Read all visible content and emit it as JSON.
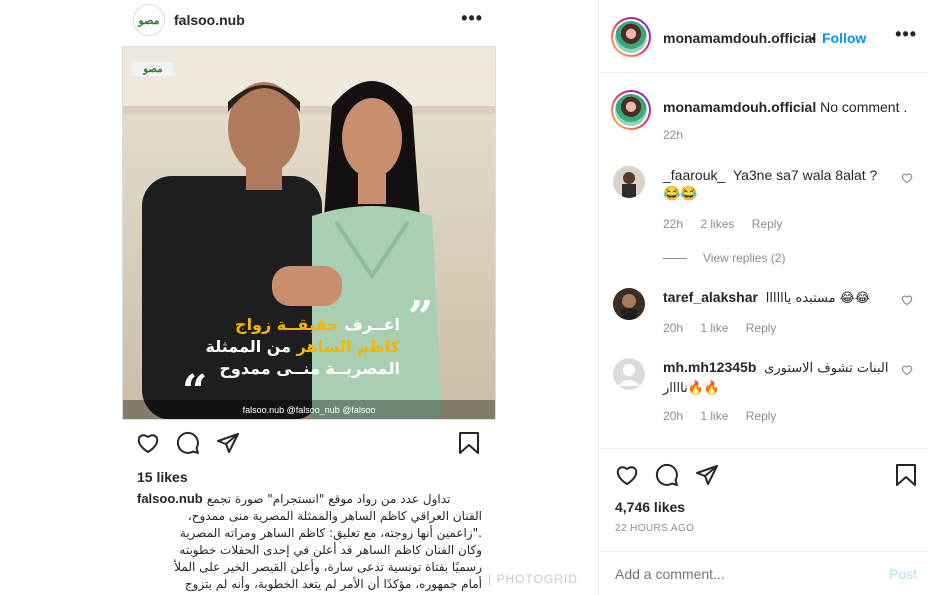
{
  "post": {
    "username": "falsoo.nub",
    "logo_text": "مصو",
    "more": "•••",
    "headline_line1_pre": "اعــرف ",
    "headline_line1_hl": "حقيقــة زواج",
    "headline_line2_hl": "كاظم الساهر",
    "headline_line2_post": " من الممثلة",
    "headline_line3": "المصريــة منــى ممدوح",
    "footer_social": "falsoo.nub  @falsoo_nub  @falsoo",
    "likes": "15 likes",
    "caption_user": "falsoo.nub",
    "caption_lines": [
      "تداول عدد من رواد موقع \"انستجرام\" صورة تجمع",
      "الفنان العراقي كاظم الساهر والممثلة المصرية منى ممدوح،",
      ".\"زاعمين أنها زوجته، مع تعليق: كاظم الساهر ومراته المصرية",
      "وكان الفنان كاظم الساهر قد أعلن في إحدى الحفلات خطوبته",
      "رسميًا بفتاة تونسية تدعى سارة، وأعلن القيصر الخير على الملأ",
      "أمام جمهوره، مؤكدًا أن الأمر لم يتعد الخطوبة، وأنه لم يتزوج"
    ],
    "watermark": "| PHOTOGRID"
  },
  "panel": {
    "username": "monamamdouh.official",
    "dot": "•",
    "follow": "Follow",
    "more": "•••"
  },
  "comments": [
    {
      "user": "monamamdouh.official",
      "text": "No comment .",
      "time": "22h"
    },
    {
      "user": "_faarouk_",
      "text": "Ya3ne sa7 wala 8alat ? 😂😂",
      "time": "22h",
      "likes": "2 likes",
      "reply": "Reply"
    },
    {
      "user": "taref_alakshar",
      "text": "مستبده ياااااا 😂😂",
      "time": "20h",
      "likes": "1 like",
      "reply": "Reply"
    },
    {
      "user": "mh.mh12345b",
      "text": "البنات تشوف الاستورى ناااار🔥🔥",
      "time": "20h",
      "likes": "1 like",
      "reply": "Reply"
    }
  ],
  "view_replies": "View replies (2)",
  "actions": {
    "likes": "4,746 likes",
    "time": "22 HOURS AGO"
  },
  "add_comment": {
    "placeholder": "Add a comment...",
    "post": "Post"
  },
  "colors": {
    "link_blue": "#0095f6",
    "muted": "#8e8e8e",
    "headline_accent": "#f3b400"
  }
}
